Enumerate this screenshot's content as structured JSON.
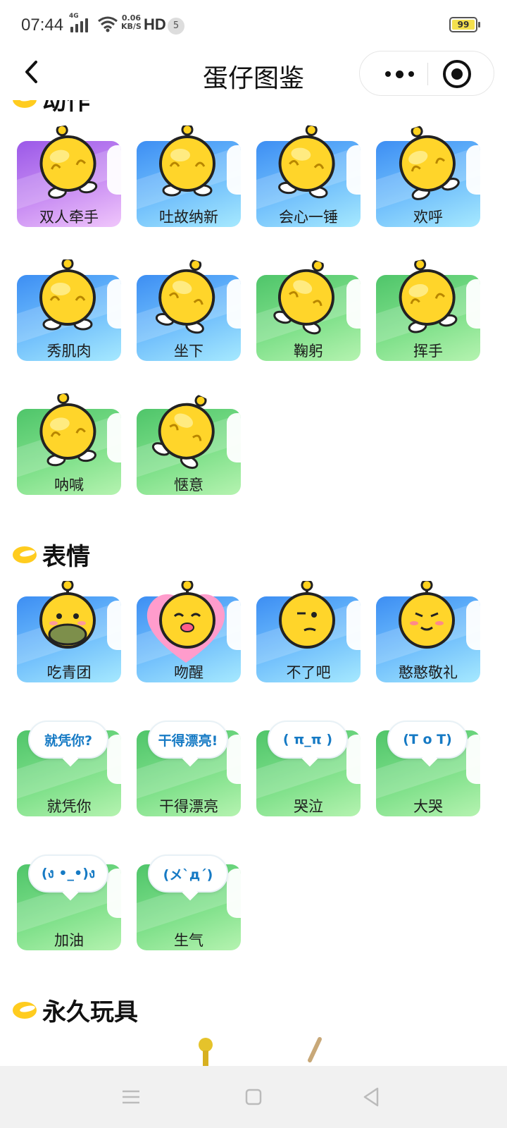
{
  "status_bar": {
    "time": "07:44",
    "network_type": "4G",
    "speed_value": "0.06",
    "speed_unit": "KB/S",
    "hd": "HD",
    "notification_count": "5",
    "battery": "99"
  },
  "header": {
    "title": "蛋仔图鉴",
    "back_icon": "chevron-left-icon",
    "more_icon": "more-dots-icon",
    "close_icon": "target-close-icon"
  },
  "sections": [
    {
      "title": "动作",
      "items": [
        {
          "label": "双人牵手",
          "theme": "purple"
        },
        {
          "label": "吐故纳新",
          "theme": "blue"
        },
        {
          "label": "会心一锤",
          "theme": "blue"
        },
        {
          "label": "欢呼",
          "theme": "blue"
        },
        {
          "label": "秀肌肉",
          "theme": "blue"
        },
        {
          "label": "坐下",
          "theme": "blue"
        },
        {
          "label": "鞠躬",
          "theme": "green"
        },
        {
          "label": "挥手",
          "theme": "green"
        },
        {
          "label": "呐喊",
          "theme": "green"
        },
        {
          "label": "惬意",
          "theme": "green"
        }
      ]
    },
    {
      "title": "表情",
      "items": [
        {
          "label": "吃青团",
          "theme": "blue"
        },
        {
          "label": "吻醒",
          "theme": "blue"
        },
        {
          "label": "不了吧",
          "theme": "blue"
        },
        {
          "label": "憨憨敬礼",
          "theme": "blue"
        },
        {
          "label": "就凭你",
          "theme": "green",
          "bubble": "就凭你?"
        },
        {
          "label": "干得漂亮",
          "theme": "green",
          "bubble": "干得漂亮!"
        },
        {
          "label": "哭泣",
          "theme": "green",
          "bubble": "( π_π )"
        },
        {
          "label": "大哭",
          "theme": "green",
          "bubble": "(T o T)"
        },
        {
          "label": "加油",
          "theme": "green",
          "bubble": "(ง •_•)ง"
        },
        {
          "label": "生气",
          "theme": "green",
          "bubble": "(メ`д´)"
        }
      ]
    },
    {
      "title": "永久玩具",
      "items": []
    }
  ],
  "nav_bar": {
    "menu_icon": "menu-icon",
    "home_icon": "square-home-icon",
    "back_icon": "triangle-back-icon"
  },
  "colors": {
    "chick_yellow": "#ffcf1d",
    "blue_card": "#4f9ef5",
    "green_card": "#5fd074",
    "purple_card": "#b27bef"
  }
}
